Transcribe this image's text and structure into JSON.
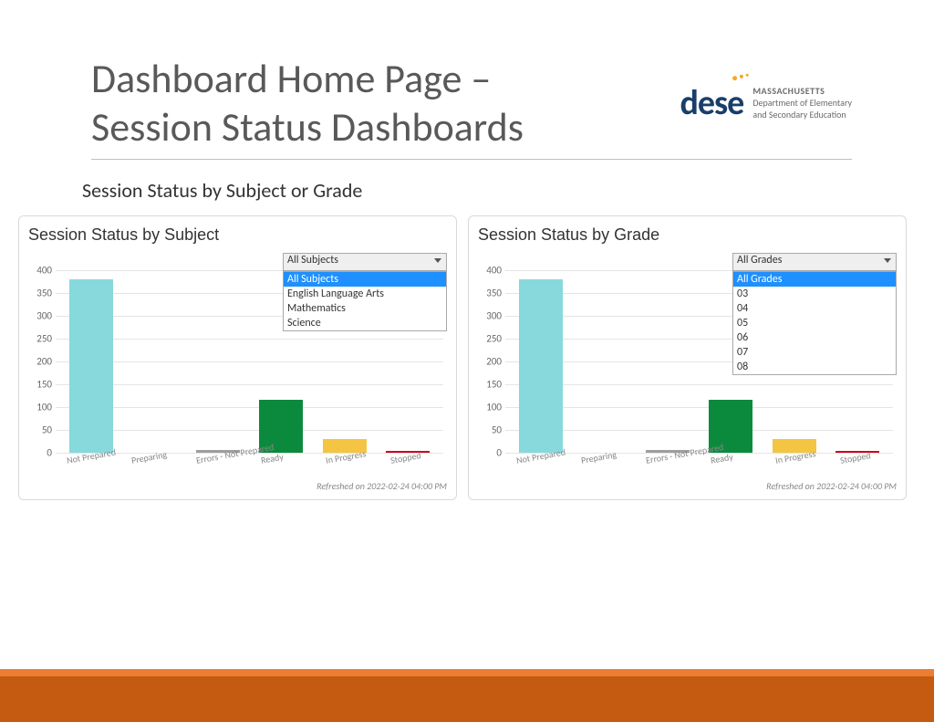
{
  "header": {
    "title_line1": "Dashboard Home Page –",
    "title_line2": "Session Status Dashboards",
    "logo_mark": "dese",
    "logo_tag_bold": "MASSACHUSETTS",
    "logo_tag_1": "Department of Elementary",
    "logo_tag_2": "and Secondary Education"
  },
  "subtitle": "Session Status by Subject or Grade",
  "chart_data": [
    {
      "type": "bar",
      "title": "Session Status by Subject",
      "categories": [
        "Not Prepared",
        "Preparing",
        "Errors - Not Prepared",
        "Ready",
        "In Progress",
        "Stopped"
      ],
      "values": [
        380,
        0,
        5,
        115,
        30,
        4
      ],
      "ylim": [
        0,
        400
      ],
      "yticks": [
        0,
        50,
        100,
        150,
        200,
        250,
        300,
        350,
        400
      ],
      "colors": [
        "#87d9dc",
        "#f4c542",
        "#9e9e9e",
        "#0b8a3e",
        "#f4c542",
        "#d0021b"
      ],
      "dropdown": {
        "selected": "All Subjects",
        "options": [
          "All Subjects",
          "English Language Arts",
          "Mathematics",
          "Science"
        ]
      },
      "refreshed": "Refreshed on 2022-02-24 04:00 PM"
    },
    {
      "type": "bar",
      "title": "Session Status by Grade",
      "categories": [
        "Not Prepared",
        "Preparing",
        "Errors - Not Prepared",
        "Ready",
        "In Progress",
        "Stopped"
      ],
      "values": [
        380,
        0,
        5,
        115,
        30,
        4
      ],
      "ylim": [
        0,
        400
      ],
      "yticks": [
        0,
        50,
        100,
        150,
        200,
        250,
        300,
        350,
        400
      ],
      "colors": [
        "#87d9dc",
        "#f4c542",
        "#9e9e9e",
        "#0b8a3e",
        "#f4c542",
        "#d0021b"
      ],
      "dropdown": {
        "selected": "All Grades",
        "options": [
          "All Grades",
          "03",
          "04",
          "05",
          "06",
          "07",
          "08"
        ]
      },
      "refreshed": "Refreshed on 2022-02-24 04:00 PM"
    }
  ]
}
